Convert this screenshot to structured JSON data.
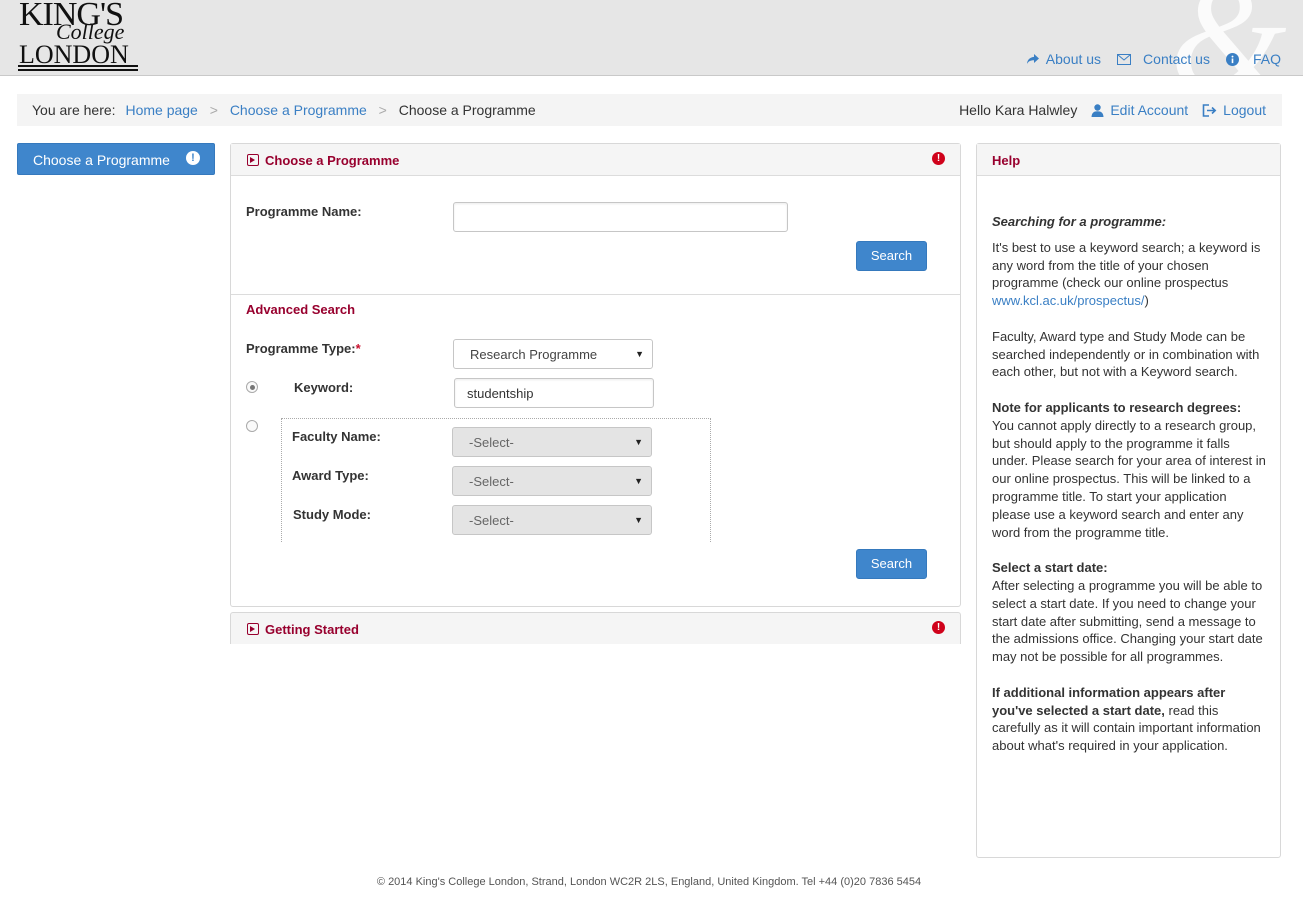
{
  "header": {
    "logo": {
      "line1": "KING'S",
      "line2": "College",
      "line3": "LONDON"
    },
    "links": [
      {
        "label": "About us",
        "icon": "share-arrow-icon"
      },
      {
        "label": "Contact us",
        "icon": "envelope-icon"
      },
      {
        "label": "FAQ",
        "icon": "info-icon"
      }
    ]
  },
  "breadcrumb": {
    "prefix": "You are here:",
    "items": [
      "Home page",
      "Choose a Programme"
    ],
    "separator": ">",
    "current": "Choose a Programme"
  },
  "user": {
    "greeting": "Hello Kara Halwley",
    "edit_account": "Edit Account",
    "logout": "Logout"
  },
  "leftnav": {
    "label": "Choose a Programme",
    "alert": "!"
  },
  "main": {
    "title": "Choose a Programme",
    "alert": "!",
    "programme_name_label": "Programme Name:",
    "programme_name_value": "",
    "search_label": "Search",
    "advanced_title": "Advanced Search",
    "programme_type_label": "Programme Type:",
    "required_mark": "*",
    "programme_type_value": "Research Programme",
    "keyword_label": "Keyword:",
    "keyword_value": "studentship",
    "faculty_label": "Faculty Name:",
    "faculty_value": "-Select-",
    "award_label": "Award Type:",
    "award_value": "-Select-",
    "study_mode_label": "Study Mode:",
    "study_mode_value": "-Select-",
    "search2_label": "Search"
  },
  "getting_started": {
    "title": "Getting Started",
    "alert": "!"
  },
  "help": {
    "title": "Help",
    "searching_heading": "Searching for a programme:",
    "searching_text": "It's best to use a keyword search; a keyword is any word from the title of your chosen programme (check our online prospectus ",
    "prospectus_link": "www.kcl.ac.uk/prospectus/",
    "searching_close": ")",
    "faculty_text": "Faculty, Award type and Study Mode can be searched independently or in combination with each other, but not with a Keyword search.",
    "note_heading": "Note for applicants to research degrees:",
    "note_text": "You cannot apply directly to a research group, but should apply to the programme it falls under. Please search for your area of interest in our online prospectus. This will be linked to a programme title. To start your application please use a keyword search and enter any word from the programme title.",
    "start_heading": "Select a start date:",
    "start_text": "After selecting a programme you will be able to select a start date. If you need to change your start date after submitting, send a message to the admissions office. Changing your start date may not be possible for all programmes.",
    "additional_bold": "If additional information appears after you've selected a start date,",
    "additional_text": " read this carefully as it will contain important information about what's required in your application."
  },
  "footer": {
    "text": "© 2014 King's College London, Strand, London WC2R 2LS, England, United Kingdom. Tel +44 (0)20 7836 5454"
  },
  "colors": {
    "accent": "#3f86cc",
    "brand": "#98002e",
    "alert": "#d0021b",
    "link": "#3a7fc4"
  }
}
